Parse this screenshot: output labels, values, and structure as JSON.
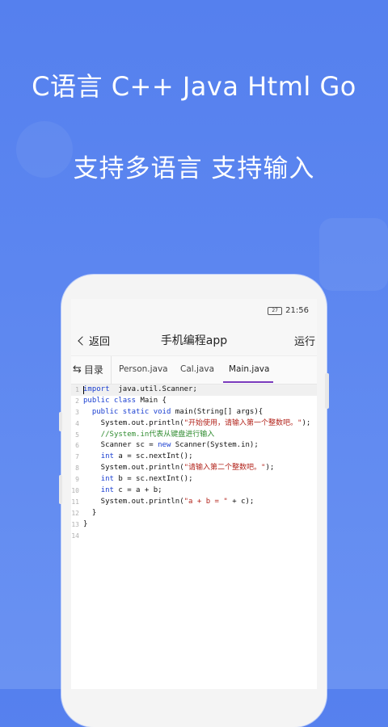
{
  "promo": {
    "headline1": "C语言 C++ Java Html Go",
    "headline2": "支持多语言 支持输入"
  },
  "status": {
    "battery": "27",
    "time": "21:56"
  },
  "appbar": {
    "back_label": "返回",
    "title": "手机编程app",
    "run_label": "运行"
  },
  "tabs": {
    "dir_label": "目录",
    "files": [
      "Person.java",
      "Cal.java",
      "Main.java"
    ],
    "active": "Main.java"
  },
  "code": {
    "line_numbers": [
      "1",
      "2",
      "3",
      "4",
      "5",
      "6",
      "7",
      "8",
      "9",
      "10",
      "11",
      "12",
      "13",
      "14"
    ],
    "lines": [
      [
        [
          "kw",
          "import"
        ],
        [
          "",
          "  java.util.Scanner;"
        ]
      ],
      [
        [
          "kw",
          "public class"
        ],
        [
          "",
          " Main {"
        ]
      ],
      [
        [
          "",
          "  "
        ],
        [
          "kw",
          "public static void"
        ],
        [
          "",
          " main(String[] args){"
        ]
      ],
      [
        [
          "",
          "    System.out.println("
        ],
        [
          "str",
          "\"开始使用，请输入第一个整数吧。\""
        ],
        [
          "",
          ");"
        ]
      ],
      [
        [
          "",
          "    "
        ],
        [
          "cm",
          "//System.in代表从键盘进行输入"
        ]
      ],
      [
        [
          "",
          "    Scanner sc = "
        ],
        [
          "kw",
          "new"
        ],
        [
          "",
          " Scanner(System.in);"
        ]
      ],
      [
        [
          "",
          "    "
        ],
        [
          "kw",
          "int"
        ],
        [
          "",
          " a = sc.nextInt();"
        ]
      ],
      [
        [
          "",
          "    System.out.println("
        ],
        [
          "str",
          "\"请输入第二个整数吧。\""
        ],
        [
          "",
          ");"
        ]
      ],
      [
        [
          "",
          "    "
        ],
        [
          "kw",
          "int"
        ],
        [
          "",
          " b = sc.nextInt();"
        ]
      ],
      [
        [
          "",
          "    "
        ],
        [
          "kw",
          "int"
        ],
        [
          "",
          " c = a + b;"
        ]
      ],
      [
        [
          "",
          "    System.out.println("
        ],
        [
          "str",
          "\"a + b = \""
        ],
        [
          "",
          " + c);"
        ]
      ],
      [
        [
          "",
          "  }"
        ]
      ],
      [
        [
          "",
          "}"
        ]
      ],
      [
        [
          "",
          ""
        ]
      ]
    ]
  },
  "colors": {
    "background": "#5580ee",
    "keyword": "#1a3fd1",
    "string": "#b3261e",
    "comment": "#2e8b2e",
    "tab_indicator": "#7a3bbd"
  }
}
